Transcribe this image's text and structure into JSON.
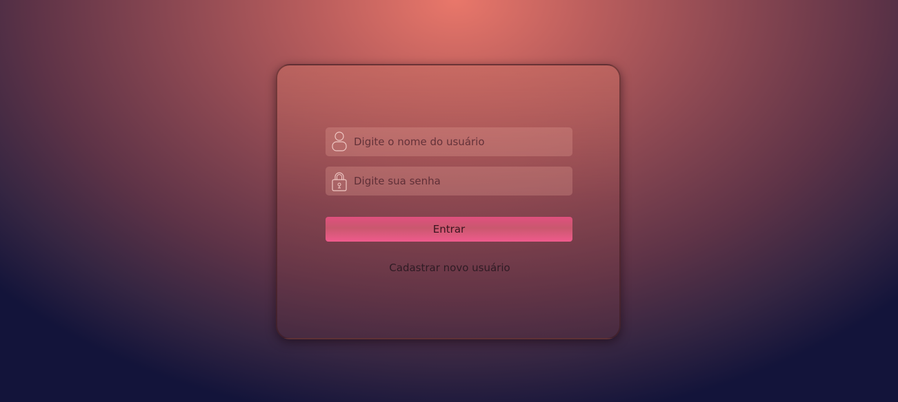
{
  "login": {
    "username_placeholder": "Digite o nome do usuário",
    "password_placeholder": "Digite sua senha",
    "submit_label": "Entrar",
    "register_link": "Cadastrar novo usuário"
  },
  "icons": {
    "username": "user-icon",
    "password": "lock-icon"
  },
  "colors": {
    "button": "#f05b8d",
    "background_top": "#e9776a",
    "background_bottom": "#13143a"
  }
}
